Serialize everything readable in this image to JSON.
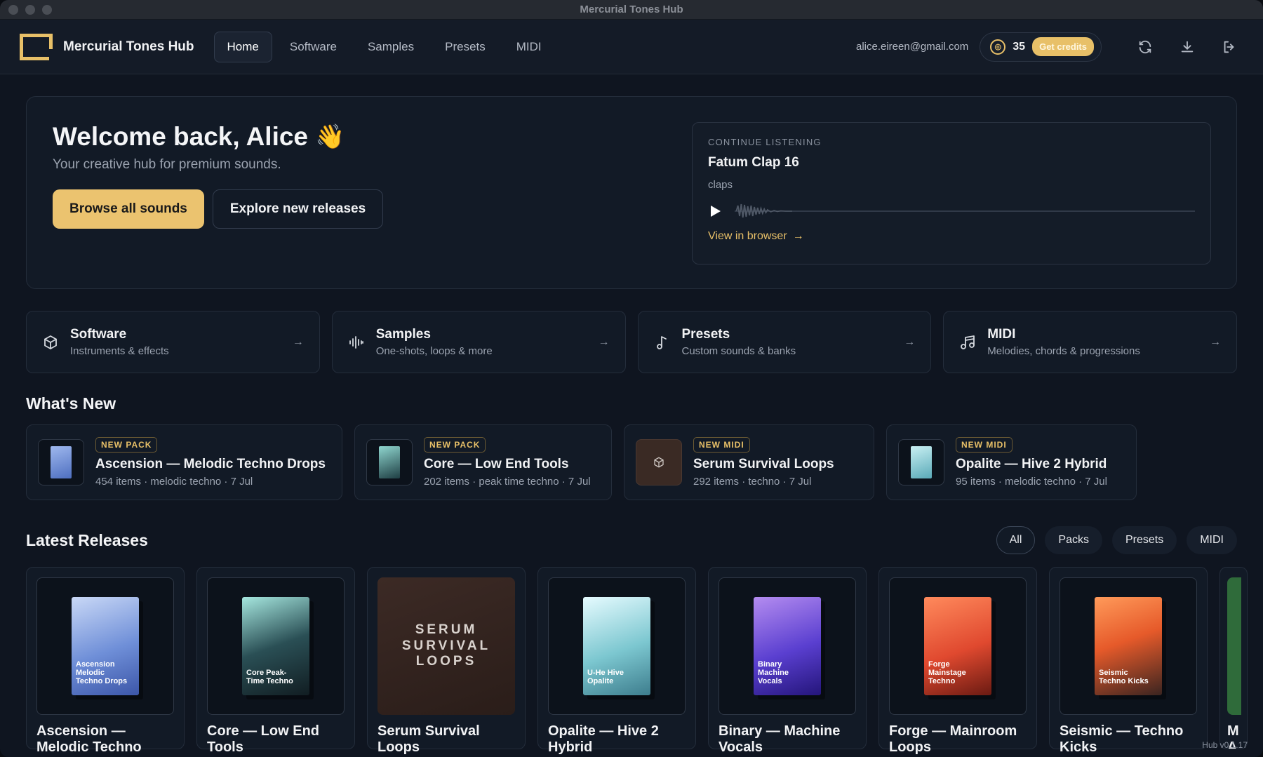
{
  "window": {
    "title": "Mercurial Tones Hub"
  },
  "appbar": {
    "brand": "Mercurial Tones Hub",
    "nav": [
      "Home",
      "Software",
      "Samples",
      "Presets",
      "MIDI"
    ],
    "email": "alice.eireen@gmail.com",
    "credits": "35",
    "get_credits": "Get credits"
  },
  "hero": {
    "title": "Welcome back, Alice",
    "emoji": "👋",
    "subtitle": "Your creative hub for premium sounds.",
    "primary_label": "Browse all sounds",
    "secondary_label": "Explore new releases"
  },
  "continue": {
    "label": "CONTINUE LISTENING",
    "title": "Fatum Clap 16",
    "category": "claps",
    "link": "View in browser",
    "progress": 0.0
  },
  "categories": [
    {
      "title": "Software",
      "sub": "Instruments & effects",
      "icon": "cube-icon"
    },
    {
      "title": "Samples",
      "sub": "One-shots, loops & more",
      "icon": "waveform-icon"
    },
    {
      "title": "Presets",
      "sub": "Custom sounds & banks",
      "icon": "music-note-icon"
    },
    {
      "title": "MIDI",
      "sub": "Melodies, chords & progressions",
      "icon": "music-notes-icon"
    }
  ],
  "whats_new": {
    "title": "What's New",
    "items": [
      {
        "badge": "NEW PACK",
        "title": "Ascension — Melodic Techno Drops",
        "meta": "454 items · melodic techno · 7 Jul"
      },
      {
        "badge": "NEW PACK",
        "title": "Core — Low End Tools",
        "meta": "202 items · peak time techno · 7 Jul"
      },
      {
        "badge": "NEW MIDI",
        "title": "Serum Survival Loops",
        "meta": "292 items · techno · 7 Jul"
      },
      {
        "badge": "NEW MIDI",
        "title": "Opalite — Hive 2 Hybrid",
        "meta": "95 items · melodic techno · 7 Jul"
      }
    ]
  },
  "latest": {
    "title": "Latest Releases",
    "filters": [
      "All",
      "Packs",
      "Presets",
      "MIDI"
    ],
    "items": [
      {
        "title": "Ascension — Melodic Techno",
        "box_text": "Ascension Melodic Techno Drops",
        "color": "#6f8fd8"
      },
      {
        "title": "Core — Low End Tools",
        "box_text": "Core Peak-Time Techno",
        "color": "#5fb8b0"
      },
      {
        "title": "Serum Survival Loops",
        "art_text": "SERUM SURVIVAL LOOPS",
        "color": "#3c2a25"
      },
      {
        "title": "Opalite — Hive 2 Hybrid",
        "box_text": "U-He Hive Opalite",
        "color": "#7cc7d0"
      },
      {
        "title": "Binary — Machine Vocals",
        "box_text": "Binary Machine Vocals",
        "color": "#5a3fd0"
      },
      {
        "title": "Forge — Mainroom Loops",
        "box_text": "Forge Mainstage Techno",
        "color": "#e0492f"
      },
      {
        "title": "Seismic — Techno Kicks",
        "box_text": "Seismic Techno Kicks",
        "color": "#e65a2a"
      },
      {
        "title": "M A",
        "color": "#2f6b3a"
      }
    ]
  },
  "version": "Hub v0.1.17",
  "colors": {
    "accent": "#ebc36f",
    "bg": "#0f1520",
    "card": "#121a26"
  }
}
